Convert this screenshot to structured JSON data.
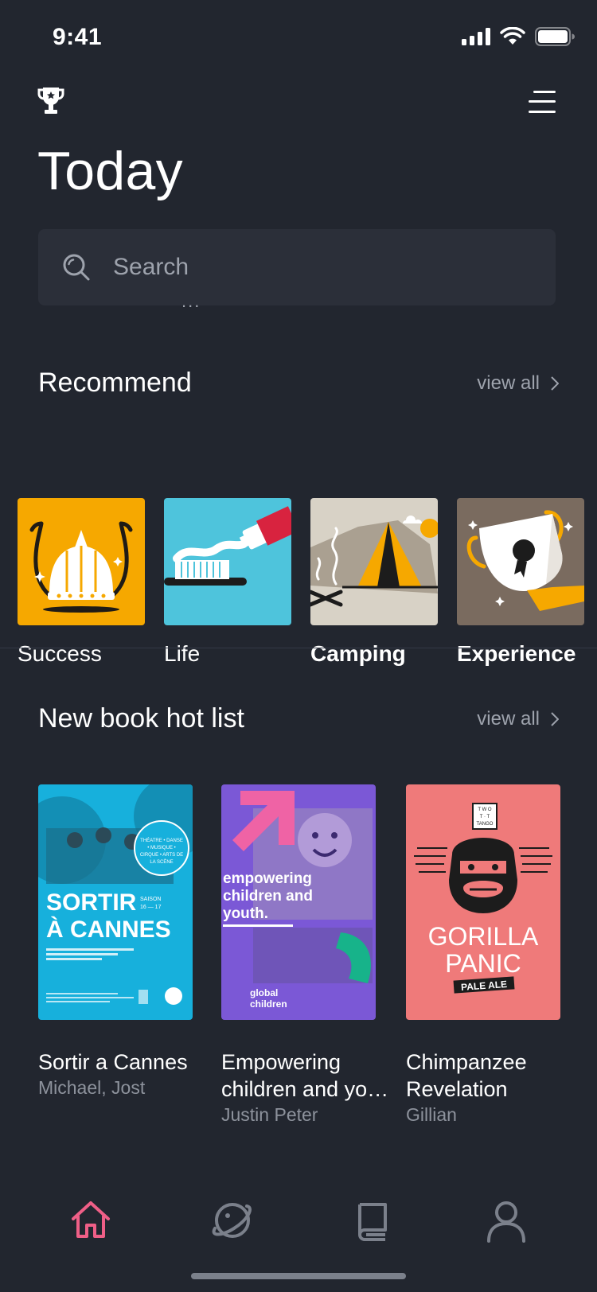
{
  "status": {
    "time": "9:41"
  },
  "header": {
    "title": "Today"
  },
  "search": {
    "placeholder": "Search",
    "dots": "..."
  },
  "recommend": {
    "title": "Recommend",
    "view_all": "view all",
    "items": [
      {
        "label": "Success",
        "icon": "viking-helmet-icon"
      },
      {
        "label": "Life",
        "icon": "toothbrush-icon"
      },
      {
        "label": "Camping",
        "icon": "tent-icon"
      },
      {
        "label": "Experience",
        "icon": "trophy-award-icon"
      }
    ]
  },
  "hot_list": {
    "title": "New book hot list",
    "view_all": "view all",
    "books": [
      {
        "title": "Sortir a Cannes",
        "author": "Michael, Jost",
        "cover": {
          "badge": "THÉATRE • DANSE • MUSIQUE • CIRQUE • ARTS DE LA SCÈNE",
          "headline_1": "SORTIR",
          "season": "SAISON 16 — 17",
          "headline_2": "À CANNES"
        }
      },
      {
        "title": "Empowering children and yo…",
        "author": "Justin Peter",
        "cover": {
          "headline": "empowering children and youth.",
          "logo": "global children"
        }
      },
      {
        "title": "Chimpanzee Revelation",
        "author": "Gillian",
        "cover": {
          "brand": "TWO TO TANGO",
          "headline_1": "GORILLA",
          "headline_2": "PANIC",
          "subline": "PALE ALE"
        }
      }
    ]
  },
  "tabs": [
    {
      "name": "home",
      "icon": "home-icon",
      "active": true
    },
    {
      "name": "explore",
      "icon": "planet-icon",
      "active": false
    },
    {
      "name": "library",
      "icon": "book-icon",
      "active": false
    },
    {
      "name": "profile",
      "icon": "user-icon",
      "active": false
    }
  ],
  "colors": {
    "background": "#22262f",
    "surface": "#2b2f39",
    "accent": "#ef5f87",
    "muted": "#9ea3ad"
  }
}
